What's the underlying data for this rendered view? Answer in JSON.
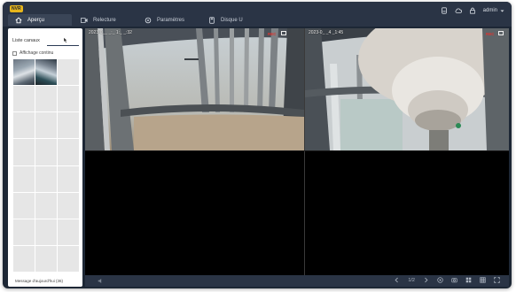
{
  "app": {
    "logo_badge": "NVR",
    "title": "NVR"
  },
  "tabs": [
    {
      "label": "Aperçu",
      "icon": "home-icon",
      "active": true
    },
    {
      "label": "Relecture",
      "icon": "playback-icon",
      "active": false
    },
    {
      "label": "Paramètres",
      "icon": "settings-icon",
      "active": false
    },
    {
      "label": "Disque U",
      "icon": "disk-icon",
      "active": false
    }
  ],
  "topright": {
    "icons": [
      "record-icon",
      "cloud-icon",
      "lock-icon"
    ],
    "user": "admin"
  },
  "sidebar": {
    "title": "Liste canaux",
    "checkbox_label": "Affichage continu",
    "footer": "Message d'aujourd'hui (36)"
  },
  "cameras": [
    {
      "timestamp": "2023-0__ _:_ 1:_ _:32",
      "rec_label": "REC"
    },
    {
      "timestamp": "2023-0_ _4 _1:45",
      "rec_label": "REC"
    }
  ],
  "bottombar": {
    "page": "1/2",
    "icons": [
      "prev-page-icon",
      "next-page-icon",
      "playback-icon",
      "snapshot-icon",
      "layout-4-icon",
      "layout-9-icon",
      "fullscreen-icon"
    ]
  },
  "colors": {
    "topbar": "#2a3445",
    "accent": "#e8b61b",
    "rec": "#e0332e"
  }
}
